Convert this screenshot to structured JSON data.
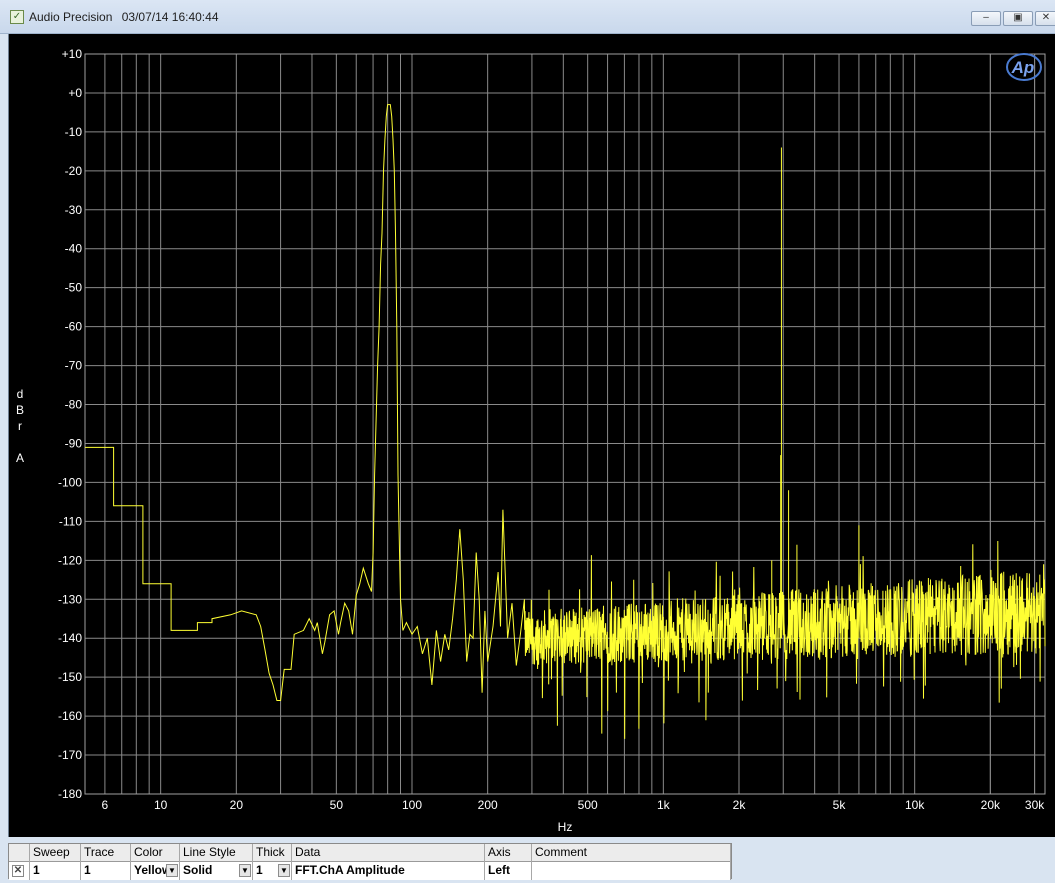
{
  "window": {
    "app_name": "Audio Precision",
    "timestamp": "03/07/14 16:40:44",
    "minimize_icon": "minimize-icon",
    "restore_icon": "restore-icon",
    "close_icon": "close-icon"
  },
  "logo_text": "Ap",
  "colors": {
    "trace": "#ffff33",
    "grid": "#8a8a8a",
    "background": "#000000",
    "axis_text": "#ffffff"
  },
  "chart_data": {
    "type": "line",
    "xlabel": "Hz",
    "ylabel_lines": [
      "d",
      "B",
      "r",
      "",
      "A"
    ],
    "x_scale": "log",
    "xlim": [
      5,
      33000
    ],
    "ylim": [
      -180,
      10
    ],
    "x_ticks": [
      {
        "v": 6,
        "label": "6"
      },
      {
        "v": 10,
        "label": "10"
      },
      {
        "v": 20,
        "label": "20"
      },
      {
        "v": 50,
        "label": "50"
      },
      {
        "v": 100,
        "label": "100"
      },
      {
        "v": 200,
        "label": "200"
      },
      {
        "v": 500,
        "label": "500"
      },
      {
        "v": 1000,
        "label": "1k"
      },
      {
        "v": 2000,
        "label": "2k"
      },
      {
        "v": 5000,
        "label": "5k"
      },
      {
        "v": 10000,
        "label": "10k"
      },
      {
        "v": 20000,
        "label": "20k"
      },
      {
        "v": 30000,
        "label": "30k"
      }
    ],
    "y_ticks": [
      {
        "v": 10,
        "label": "+10"
      },
      {
        "v": 0,
        "label": "+0"
      },
      {
        "v": -10,
        "label": "-10"
      },
      {
        "v": -20,
        "label": "-20"
      },
      {
        "v": -30,
        "label": "-30"
      },
      {
        "v": -40,
        "label": "-40"
      },
      {
        "v": -50,
        "label": "-50"
      },
      {
        "v": -60,
        "label": "-60"
      },
      {
        "v": -70,
        "label": "-70"
      },
      {
        "v": -80,
        "label": "-80"
      },
      {
        "v": -90,
        "label": "-90"
      },
      {
        "v": -100,
        "label": "-100"
      },
      {
        "v": -110,
        "label": "-110"
      },
      {
        "v": -120,
        "label": "-120"
      },
      {
        "v": -130,
        "label": "-130"
      },
      {
        "v": -140,
        "label": "-140"
      },
      {
        "v": -150,
        "label": "-150"
      },
      {
        "v": -160,
        "label": "-160"
      },
      {
        "v": -170,
        "label": "-170"
      },
      {
        "v": -180,
        "label": "-180"
      }
    ],
    "grid": true,
    "series": [
      {
        "color": "#ffff33",
        "points": [
          [
            5,
            -91
          ],
          [
            6.5,
            -91
          ],
          [
            6.5,
            -106
          ],
          [
            8.5,
            -106
          ],
          [
            8.5,
            -126
          ],
          [
            11,
            -126
          ],
          [
            11,
            -138
          ],
          [
            14,
            -138
          ],
          [
            14,
            -136
          ],
          [
            16,
            -136
          ],
          [
            16,
            -135
          ],
          [
            19,
            -134
          ],
          [
            21,
            -133
          ],
          [
            24,
            -134
          ],
          [
            25,
            -137
          ],
          [
            26,
            -143
          ],
          [
            27,
            -149
          ],
          [
            28,
            -152
          ],
          [
            29,
            -156
          ],
          [
            30,
            -156
          ],
          [
            31,
            -148
          ],
          [
            33,
            -148
          ],
          [
            34,
            -139
          ],
          [
            37,
            -138
          ],
          [
            39,
            -135
          ],
          [
            41,
            -138
          ],
          [
            42,
            -136
          ],
          [
            44,
            -144
          ],
          [
            45,
            -141
          ],
          [
            47,
            -134
          ],
          [
            49,
            -133
          ],
          [
            51,
            -139
          ],
          [
            52,
            -136
          ],
          [
            54,
            -131
          ],
          [
            56,
            -133
          ],
          [
            58,
            -139
          ],
          [
            60,
            -129
          ],
          [
            62,
            -126
          ],
          [
            64,
            -122
          ],
          [
            67,
            -126
          ],
          [
            69,
            -128
          ],
          [
            70,
            -118
          ],
          [
            71,
            -98
          ],
          [
            72,
            -84
          ],
          [
            73,
            -70
          ],
          [
            74,
            -60
          ],
          [
            75,
            -44
          ],
          [
            76,
            -36
          ],
          [
            77,
            -20
          ],
          [
            78,
            -12
          ],
          [
            79,
            -6
          ],
          [
            80,
            -3
          ],
          [
            82,
            -3
          ],
          [
            83,
            -6
          ],
          [
            84,
            -12
          ],
          [
            85,
            -20
          ],
          [
            86,
            -36
          ],
          [
            87,
            -60
          ],
          [
            88,
            -98
          ],
          [
            89,
            -115
          ],
          [
            90,
            -130
          ],
          [
            92,
            -138
          ],
          [
            95,
            -136
          ],
          [
            100,
            -139
          ],
          [
            105,
            -137
          ],
          [
            110,
            -144
          ],
          [
            115,
            -140
          ],
          [
            120,
            -152
          ],
          [
            125,
            -138
          ],
          [
            130,
            -146
          ],
          [
            135,
            -139
          ],
          [
            140,
            -143
          ],
          [
            145,
            -135
          ],
          [
            150,
            -125
          ],
          [
            155,
            -112
          ],
          [
            160,
            -125
          ],
          [
            165,
            -146
          ],
          [
            170,
            -139
          ],
          [
            175,
            -140
          ],
          [
            180,
            -118
          ],
          [
            185,
            -130
          ],
          [
            190,
            -154
          ],
          [
            195,
            -133
          ],
          [
            200,
            -146
          ],
          [
            210,
            -137
          ],
          [
            220,
            -123
          ],
          [
            225,
            -137
          ],
          [
            230,
            -107
          ],
          [
            240,
            -140
          ],
          [
            250,
            -131
          ],
          [
            260,
            -147
          ],
          [
            270,
            -139
          ],
          [
            280,
            -130
          ]
        ],
        "spikes": [
          {
            "x": 2950,
            "y": -14
          },
          {
            "x": 2930,
            "y": -93
          },
          {
            "x": 2700,
            "y": -120
          },
          {
            "x": 3150,
            "y": -102
          },
          {
            "x": 3400,
            "y": -116
          },
          {
            "x": 6000,
            "y": -111
          }
        ],
        "noise_floor": {
          "from_hz": 280,
          "to_hz": 33000,
          "mean_start": -140,
          "mean_end": -133,
          "spread_start": 7,
          "spread_end": 11
        }
      }
    ]
  },
  "table": {
    "headers": [
      "Sweep",
      "Trace",
      "Color",
      "Line Style",
      "Thick",
      "Data",
      "Axis",
      "Comment"
    ],
    "row": {
      "enabled_icon": "checkbox-checked-icon",
      "sweep": "1",
      "trace": "1",
      "color": "Yellow",
      "line_style": "Solid",
      "thick": "1",
      "data": "FFT.ChA Amplitude",
      "axis": "Left",
      "comment": ""
    }
  }
}
